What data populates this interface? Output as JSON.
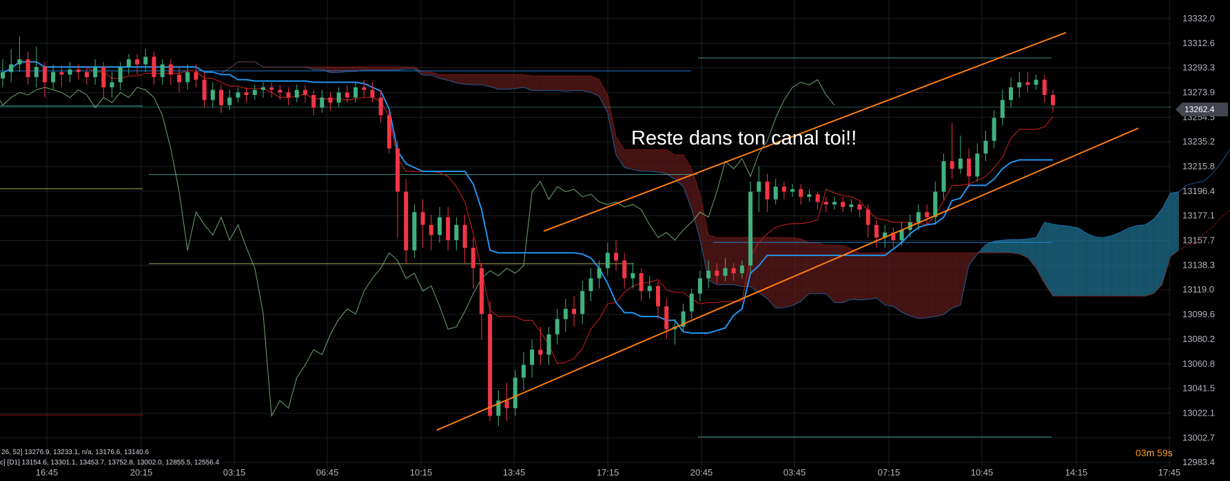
{
  "chart_data": {
    "type": "candlestick",
    "annotation": "Reste dans ton canal toi!!",
    "countdown": "03m 59s",
    "countdown_parts": {
      "minutes": "03",
      "minutes_unit": "m",
      "seconds": "59",
      "seconds_unit": "s"
    },
    "last_price": "13262.4",
    "ylim": [
      2983.4,
      13341.0
    ],
    "y_tick_labels": [
      "13332.0",
      "13312.6",
      "13293.3",
      "13273.9",
      "13254.5",
      "13235.2",
      "13215.8",
      "13196.4",
      "13177.1",
      "13157.7",
      "13138.3",
      "13119.0",
      "13099.6",
      "13080.2",
      "13060.8",
      "13041.5",
      "13022.1",
      "13002.7",
      "12983.4"
    ],
    "y_tick_values": [
      13332.0,
      13312.6,
      13293.3,
      13273.9,
      13254.5,
      13235.2,
      13215.8,
      13196.4,
      13177.1,
      13157.7,
      13138.3,
      13119.0,
      13099.6,
      13080.2,
      13060.8,
      13041.5,
      13022.1,
      13002.7,
      12983.4
    ],
    "x_tick_labels": [
      "16:45",
      "20:15",
      "03:15",
      "06:45",
      "10:15",
      "13:45",
      "17:15",
      "20:45",
      "03:45",
      "07:15",
      "10:45",
      "14:15",
      "17:45"
    ],
    "legend": {
      "line1": "26, 52] 13276.9, 13233.1, n/a, 13176.6, 13140.6",
      "line2": "c] [D1] 13154.6, 13301.1, 13453.7, 13752.8, 13002.0, 12855.5, 12556.4"
    },
    "colors": {
      "up": "#26a69a",
      "up_body": "#3fb27f",
      "down": "#f23645",
      "kijun": "#2196f3",
      "tenkan": "#b71c1c",
      "chikou": "#81c784",
      "channel": "#ff7f0e",
      "cloud_bull": "#1e6d8c",
      "cloud_bear": "#5b1a1a",
      "level_green": "#4db6ac",
      "level_yellow": "#c8c864",
      "last_price_tag": "#434651"
    },
    "candles": [
      [
        13285,
        13290,
        13278,
        13300
      ],
      [
        13290,
        13296,
        13282,
        13308
      ],
      [
        13296,
        13300,
        13290,
        13318
      ],
      [
        13300,
        13286,
        13280,
        13306
      ],
      [
        13286,
        13294,
        13278,
        13310
      ],
      [
        13294,
        13282,
        13270,
        13298
      ],
      [
        13282,
        13290,
        13276,
        13296
      ],
      [
        13290,
        13288,
        13278,
        13295
      ],
      [
        13288,
        13292,
        13282,
        13298
      ],
      [
        13292,
        13290,
        13284,
        13296
      ],
      [
        13290,
        13286,
        13280,
        13294
      ],
      [
        13286,
        13294,
        13280,
        13300
      ],
      [
        13294,
        13278,
        13270,
        13298
      ],
      [
        13278,
        13282,
        13270,
        13290
      ],
      [
        13282,
        13294,
        13276,
        13298
      ],
      [
        13294,
        13300,
        13288,
        13304
      ],
      [
        13300,
        13296,
        13288,
        13304
      ],
      [
        13296,
        13302,
        13290,
        13308
      ],
      [
        13302,
        13286,
        13280,
        13306
      ],
      [
        13286,
        13296,
        13280,
        13300
      ],
      [
        13296,
        13288,
        13280,
        13300
      ],
      [
        13288,
        13282,
        13274,
        13294
      ],
      [
        13282,
        13290,
        13276,
        13296
      ],
      [
        13290,
        13284,
        13278,
        13296
      ],
      [
        13284,
        13268,
        13262,
        13290
      ],
      [
        13268,
        13276,
        13262,
        13282
      ],
      [
        13276,
        13264,
        13258,
        13280
      ],
      [
        13264,
        13270,
        13260,
        13276
      ],
      [
        13270,
        13274,
        13266,
        13278
      ],
      [
        13274,
        13272,
        13266,
        13278
      ],
      [
        13272,
        13276,
        13268,
        13280
      ],
      [
        13276,
        13278,
        13270,
        13282
      ],
      [
        13278,
        13276,
        13270,
        13282
      ],
      [
        13276,
        13274,
        13268,
        13280
      ],
      [
        13274,
        13270,
        13264,
        13278
      ],
      [
        13270,
        13276,
        13266,
        13280
      ],
      [
        13276,
        13272,
        13266,
        13280
      ],
      [
        13272,
        13262,
        13256,
        13276
      ],
      [
        13262,
        13270,
        13258,
        13276
      ],
      [
        13270,
        13266,
        13260,
        13274
      ],
      [
        13266,
        13274,
        13262,
        13278
      ],
      [
        13274,
        13270,
        13266,
        13280
      ],
      [
        13270,
        13278,
        13266,
        13282
      ],
      [
        13278,
        13276,
        13270,
        13284
      ],
      [
        13276,
        13270,
        13266,
        13282
      ],
      [
        13270,
        13256,
        13250,
        13276
      ],
      [
        13256,
        13230,
        13226,
        13260
      ],
      [
        13230,
        13196,
        13160,
        13236
      ],
      [
        13196,
        13150,
        13140,
        13206
      ],
      [
        13150,
        13180,
        13144,
        13186
      ],
      [
        13180,
        13170,
        13152,
        13190
      ],
      [
        13170,
        13162,
        13150,
        13178
      ],
      [
        13162,
        13176,
        13156,
        13184
      ],
      [
        13176,
        13158,
        13150,
        13184
      ],
      [
        13158,
        13170,
        13150,
        13176
      ],
      [
        13170,
        13152,
        13140,
        13178
      ],
      [
        13152,
        13136,
        13120,
        13160
      ],
      [
        13136,
        13100,
        13080,
        13140
      ],
      [
        13100,
        13020,
        13016,
        13110
      ],
      [
        13020,
        13032,
        13012,
        13040
      ],
      [
        13032,
        13026,
        13016,
        13046
      ],
      [
        13026,
        13050,
        13020,
        13056
      ],
      [
        13050,
        13060,
        13040,
        13070
      ],
      [
        13060,
        13072,
        13050,
        13080
      ],
      [
        13072,
        13068,
        13060,
        13090
      ],
      [
        13068,
        13084,
        13060,
        13090
      ],
      [
        13084,
        13096,
        13076,
        13104
      ],
      [
        13096,
        13104,
        13086,
        13112
      ],
      [
        13104,
        13100,
        13090,
        13114
      ],
      [
        13100,
        13118,
        13092,
        13126
      ],
      [
        13118,
        13128,
        13110,
        13136
      ],
      [
        13128,
        13136,
        13120,
        13142
      ],
      [
        13136,
        13148,
        13130,
        13156
      ],
      [
        13148,
        13142,
        13134,
        13158
      ],
      [
        13142,
        13128,
        13120,
        13148
      ],
      [
        13128,
        13132,
        13120,
        13140
      ],
      [
        13132,
        13118,
        13110,
        13136
      ],
      [
        13118,
        13122,
        13112,
        13130
      ],
      [
        13122,
        13106,
        13096,
        13126
      ],
      [
        13106,
        13088,
        13080,
        13112
      ],
      [
        13088,
        13090,
        13076,
        13096
      ],
      [
        13090,
        13102,
        13086,
        13108
      ],
      [
        13102,
        13116,
        13096,
        13120
      ],
      [
        13116,
        13128,
        13110,
        13134
      ],
      [
        13128,
        13134,
        13120,
        13142
      ],
      [
        13134,
        13130,
        13124,
        13140
      ],
      [
        13130,
        13136,
        13126,
        13144
      ],
      [
        13136,
        13132,
        13126,
        13140
      ],
      [
        13132,
        13138,
        13128,
        13142
      ],
      [
        13138,
        13196,
        13132,
        13204
      ],
      [
        13196,
        13204,
        13180,
        13216
      ],
      [
        13204,
        13190,
        13180,
        13210
      ],
      [
        13190,
        13200,
        13186,
        13206
      ],
      [
        13200,
        13196,
        13190,
        13204
      ],
      [
        13196,
        13198,
        13192,
        13202
      ],
      [
        13198,
        13192,
        13186,
        13202
      ],
      [
        13192,
        13194,
        13188,
        13198
      ],
      [
        13194,
        13188,
        13182,
        13196
      ],
      [
        13188,
        13186,
        13180,
        13192
      ],
      [
        13186,
        13188,
        13182,
        13192
      ],
      [
        13188,
        13184,
        13180,
        13192
      ],
      [
        13184,
        13186,
        13180,
        13190
      ],
      [
        13186,
        13182,
        13176,
        13188
      ],
      [
        13182,
        13170,
        13160,
        13186
      ],
      [
        13170,
        13160,
        13152,
        13174
      ],
      [
        13160,
        13164,
        13152,
        13170
      ],
      [
        13164,
        13158,
        13152,
        13168
      ],
      [
        13158,
        13166,
        13154,
        13172
      ],
      [
        13166,
        13172,
        13160,
        13178
      ],
      [
        13172,
        13180,
        13166,
        13186
      ],
      [
        13180,
        13176,
        13170,
        13186
      ],
      [
        13176,
        13196,
        13170,
        13204
      ],
      [
        13196,
        13220,
        13190,
        13226
      ],
      [
        13220,
        13214,
        13206,
        13250
      ],
      [
        13214,
        13222,
        13210,
        13240
      ],
      [
        13222,
        13208,
        13200,
        13230
      ],
      [
        13208,
        13226,
        13204,
        13234
      ],
      [
        13226,
        13236,
        13220,
        13244
      ],
      [
        13236,
        13254,
        13230,
        13260
      ],
      [
        13254,
        13268,
        13248,
        13276
      ],
      [
        13268,
        13278,
        13262,
        13286
      ],
      [
        13278,
        13282,
        13270,
        13290
      ],
      [
        13282,
        13280,
        13274,
        13290
      ],
      [
        13280,
        13284,
        13276,
        13288
      ],
      [
        13284,
        13272,
        13266,
        13288
      ],
      [
        13272,
        13264,
        13258,
        13276
      ]
    ]
  }
}
